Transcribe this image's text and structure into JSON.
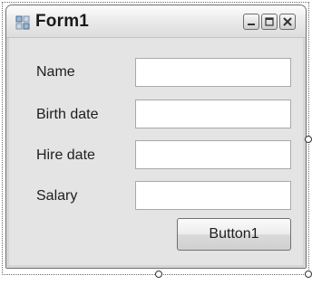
{
  "form": {
    "title": "Form1",
    "controls": {
      "minimize": "minimize-icon",
      "maximize": "maximize-icon",
      "close": "close-icon"
    }
  },
  "fields": [
    {
      "label": "Name",
      "value": ""
    },
    {
      "label": "Birth date",
      "value": ""
    },
    {
      "label": "Hire date",
      "value": ""
    },
    {
      "label": "Salary",
      "value": ""
    }
  ],
  "button": {
    "label": "Button1"
  },
  "colors": {
    "form_background": "#e4e4e4",
    "input_background": "#ffffff",
    "input_border": "#a9a9a9"
  }
}
